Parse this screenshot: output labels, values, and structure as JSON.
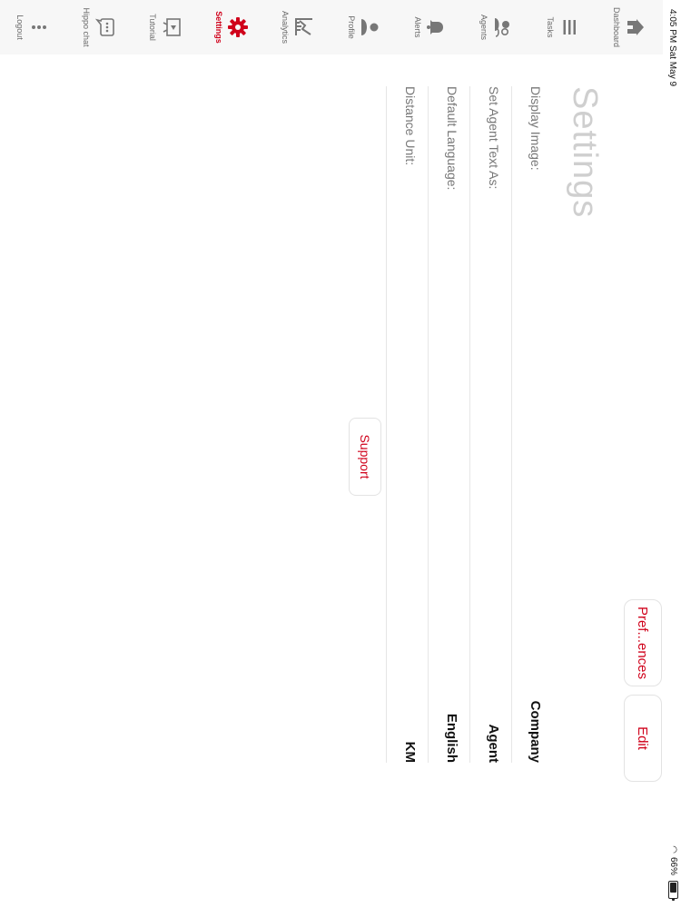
{
  "status": {
    "time": "4:05 PM   Sat May 9",
    "battery": "66%",
    "battery_level": 0.66
  },
  "nav": {
    "items": [
      {
        "label": "Dashboard",
        "icon": "house-icon"
      },
      {
        "label": "Tasks",
        "icon": "tasks-icon"
      },
      {
        "label": "Agents",
        "icon": "agents-icon"
      },
      {
        "label": "Alerts",
        "icon": "bell-icon"
      },
      {
        "label": "Profile",
        "icon": "person-icon"
      },
      {
        "label": "Analytics",
        "icon": "analytics-icon"
      },
      {
        "label": "Settings",
        "icon": "gear-icon",
        "active": true
      },
      {
        "label": "Tutorial",
        "icon": "tutorial-icon"
      },
      {
        "label": "Hippo chat",
        "icon": "chat-icon"
      },
      {
        "label": "Logout",
        "icon": "dots-icon"
      }
    ]
  },
  "main": {
    "title": "Settings",
    "tabs": {
      "preferences": "Pref...ences",
      "edit": "Edit"
    },
    "rows": [
      {
        "label": "Display Image:",
        "value": "Company"
      },
      {
        "label": "Set Agent Text As:",
        "value": "Agent"
      },
      {
        "label": "Default Language:",
        "value": "English"
      },
      {
        "label": "Distance Unit:",
        "value": "KM"
      }
    ],
    "support_label": "Support"
  },
  "colors": {
    "accent": "#d0021b",
    "title": "#cfcfcf",
    "label": "#777777",
    "sidebar_bg": "#f7f7f7"
  }
}
